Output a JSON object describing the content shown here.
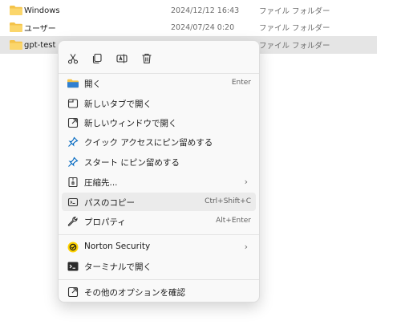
{
  "files": [
    {
      "name": "Windows",
      "date": "2024/12/12 16:43",
      "type": "ファイル フォルダー"
    },
    {
      "name": "ユーザー",
      "date": "2024/07/24 0:20",
      "type": "ファイル フォルダー"
    },
    {
      "name": "gpt-test",
      "date": "",
      "type": "ファイル フォルダー"
    }
  ],
  "menu": {
    "toolbar": [
      "cut-icon",
      "copy-icon",
      "rename-icon",
      "delete-icon"
    ],
    "items": [
      {
        "label": "開く",
        "shortcut": "Enter",
        "icon": "folder-open-icon"
      },
      {
        "label": "新しいタブで開く",
        "shortcut": "",
        "icon": "new-tab-icon"
      },
      {
        "label": "新しいウィンドウで開く",
        "shortcut": "",
        "icon": "new-window-icon"
      },
      {
        "label": "クイック アクセスにピン留めする",
        "shortcut": "",
        "icon": "pin-icon"
      },
      {
        "label": "スタート にピン留めする",
        "shortcut": "",
        "icon": "pin-icon"
      },
      {
        "label": "圧縮先...",
        "shortcut": "",
        "icon": "archive-icon"
      },
      {
        "label": "パスのコピー",
        "shortcut": "Ctrl+Shift+C",
        "icon": "copy-path-icon"
      },
      {
        "label": "プロパティ",
        "shortcut": "Alt+Enter",
        "icon": "wrench-icon"
      },
      {
        "label": "Norton Security",
        "shortcut": "",
        "icon": "norton-icon"
      },
      {
        "label": "ターミナルで開く",
        "shortcut": "",
        "icon": "terminal-icon"
      },
      {
        "label": "その他のオプションを確認",
        "shortcut": "",
        "icon": "more-options-icon"
      }
    ]
  },
  "colors": {
    "accent": "#0067c0",
    "folder": "#f4c34a",
    "selected_row": "#e5e5e5",
    "hover_item": "#ebebeb",
    "norton": "#ffd200"
  }
}
